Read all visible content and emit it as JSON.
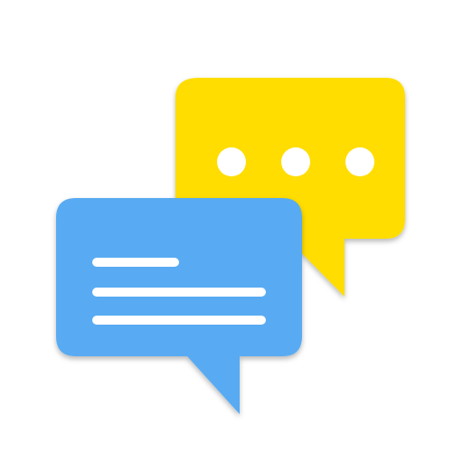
{
  "icon": {
    "name": "chat-bubbles-icon",
    "background_color": "#ffffff",
    "yellow_bubble": {
      "color": "#FFDD00",
      "content": "typing-dots",
      "dot_color": "#ffffff",
      "dot_count": 3
    },
    "blue_bubble": {
      "color": "#58ABF2",
      "content": "text-lines",
      "line_color": "#ffffff",
      "line_count": 3
    }
  }
}
